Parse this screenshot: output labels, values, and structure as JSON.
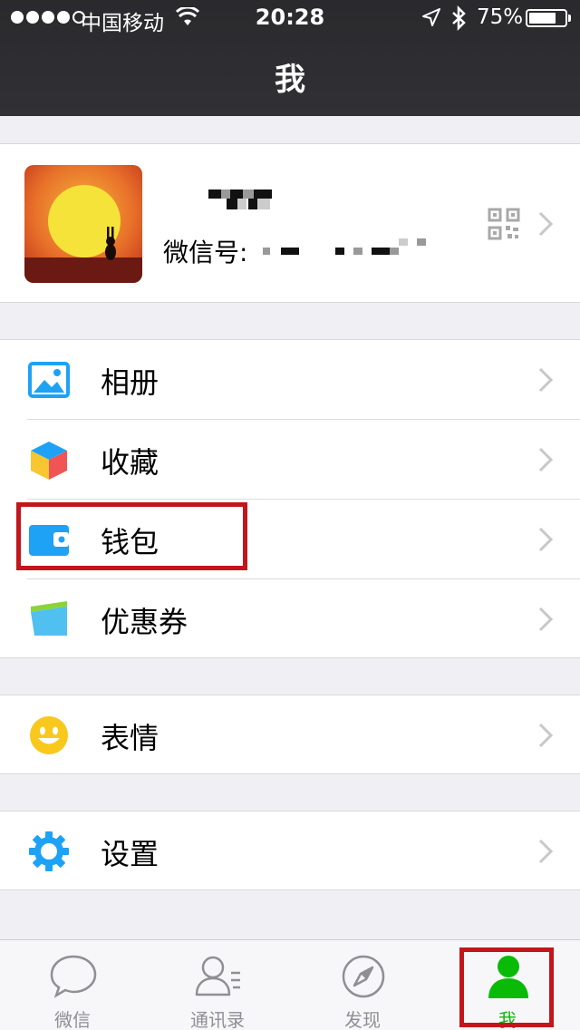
{
  "status_bar": {
    "carrier": "中国移动",
    "time": "20:28",
    "battery_percent": "75%",
    "battery_level": 0.75,
    "signal_bars_filled": 4,
    "signal_bars_total": 5
  },
  "nav": {
    "title": "我"
  },
  "profile": {
    "wechat_id_label": "微信号:"
  },
  "menu": {
    "album": {
      "label": "相册",
      "icon": "album-icon"
    },
    "favorites": {
      "label": "收藏",
      "icon": "favorites-icon"
    },
    "wallet": {
      "label": "钱包",
      "icon": "wallet-icon"
    },
    "coupons": {
      "label": "优惠券",
      "icon": "coupons-icon"
    },
    "stickers": {
      "label": "表情",
      "icon": "smiley-icon"
    },
    "settings": {
      "label": "设置",
      "icon": "gear-icon"
    }
  },
  "tabbar": {
    "chats": {
      "label": "微信",
      "icon": "chat-bubble-icon"
    },
    "contacts": {
      "label": "通讯录",
      "icon": "contacts-icon"
    },
    "discover": {
      "label": "发现",
      "icon": "compass-icon"
    },
    "me": {
      "label": "我",
      "icon": "person-icon",
      "active": true
    }
  },
  "colors": {
    "accent_green": "#09bb07",
    "highlight_red": "#c2151c",
    "nav_bg": "#2e2e31",
    "icon_blue": "#1ea2f5"
  }
}
